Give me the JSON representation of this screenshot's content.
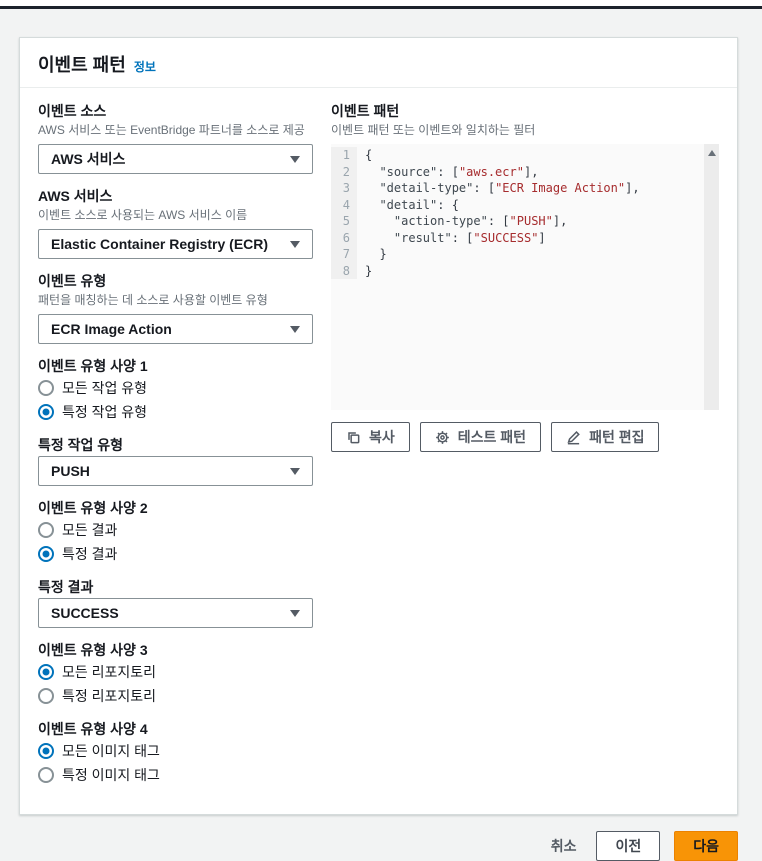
{
  "colors": {
    "accent_blue": "#0073bb",
    "primary_orange": "#f89406",
    "code_string_red": "#a62c2e",
    "page_background": "#f2f3f3",
    "label_dark": "#16191f",
    "description_gray": "#687078"
  },
  "icons": {
    "chevron-down-icon": "▼",
    "scroll-up-arrow-icon": "▲",
    "copy-icon": "overlapping-squares",
    "gear-icon": "gear",
    "pencil-icon": "pencil"
  },
  "panel": {
    "title": "이벤트 패턴",
    "info_link": "정보"
  },
  "form": {
    "event_source": {
      "label": "이벤트 소스",
      "description": "AWS 서비스 또는 EventBridge 파트너를 소스로 제공",
      "value": "AWS 서비스"
    },
    "aws_service": {
      "label": "AWS 서비스",
      "description": "이벤트 소스로 사용되는 AWS 서비스 이름",
      "value": "Elastic Container Registry (ECR)"
    },
    "event_type": {
      "label": "이벤트 유형",
      "description": "패턴을 매칭하는 데 소스로 사용할 이벤트 유형",
      "value": "ECR Image Action"
    },
    "spec1": {
      "label": "이벤트 유형 사양 1",
      "options": [
        {
          "label": "모든 작업 유형",
          "selected": false
        },
        {
          "label": "특정 작업 유형",
          "selected": true
        }
      ]
    },
    "specific_action": {
      "label": "특정 작업 유형",
      "value": "PUSH"
    },
    "spec2": {
      "label": "이벤트 유형 사양 2",
      "options": [
        {
          "label": "모든 결과",
          "selected": false
        },
        {
          "label": "특정 결과",
          "selected": true
        }
      ]
    },
    "specific_result": {
      "label": "특정 결과",
      "value": "SUCCESS"
    },
    "spec3": {
      "label": "이벤트 유형 사양 3",
      "options": [
        {
          "label": "모든 리포지토리",
          "selected": true
        },
        {
          "label": "특정 리포지토리",
          "selected": false
        }
      ]
    },
    "spec4": {
      "label": "이벤트 유형 사양 4",
      "options": [
        {
          "label": "모든 이미지 태그",
          "selected": true
        },
        {
          "label": "특정 이미지 태그",
          "selected": false
        }
      ]
    }
  },
  "pattern": {
    "label": "이벤트 패턴",
    "description": "이벤트 패턴 또는 이벤트와 일치하는 필터",
    "buttons": {
      "copy": "복사",
      "test": "테스트 패턴",
      "edit": "패턴 편집"
    },
    "code": [
      [
        [
          "p",
          "{"
        ]
      ],
      [
        [
          "p",
          "  "
        ],
        [
          "k",
          "\"source\""
        ],
        [
          "p",
          ": ["
        ],
        [
          "s",
          "\"aws.ecr\""
        ],
        [
          "p",
          "],"
        ]
      ],
      [
        [
          "p",
          "  "
        ],
        [
          "k",
          "\"detail-type\""
        ],
        [
          "p",
          ": ["
        ],
        [
          "s",
          "\"ECR Image Action\""
        ],
        [
          "p",
          "],"
        ]
      ],
      [
        [
          "p",
          "  "
        ],
        [
          "k",
          "\"detail\""
        ],
        [
          "p",
          ": {"
        ]
      ],
      [
        [
          "p",
          "    "
        ],
        [
          "k",
          "\"action-type\""
        ],
        [
          "p",
          ": ["
        ],
        [
          "s",
          "\"PUSH\""
        ],
        [
          "p",
          "],"
        ]
      ],
      [
        [
          "p",
          "    "
        ],
        [
          "k",
          "\"result\""
        ],
        [
          "p",
          ": ["
        ],
        [
          "s",
          "\"SUCCESS\""
        ],
        [
          "p",
          "]"
        ]
      ],
      [
        [
          "p",
          "  }"
        ]
      ],
      [
        [
          "p",
          "}"
        ]
      ]
    ]
  },
  "footer": {
    "cancel": "취소",
    "previous": "이전",
    "next": "다음"
  }
}
